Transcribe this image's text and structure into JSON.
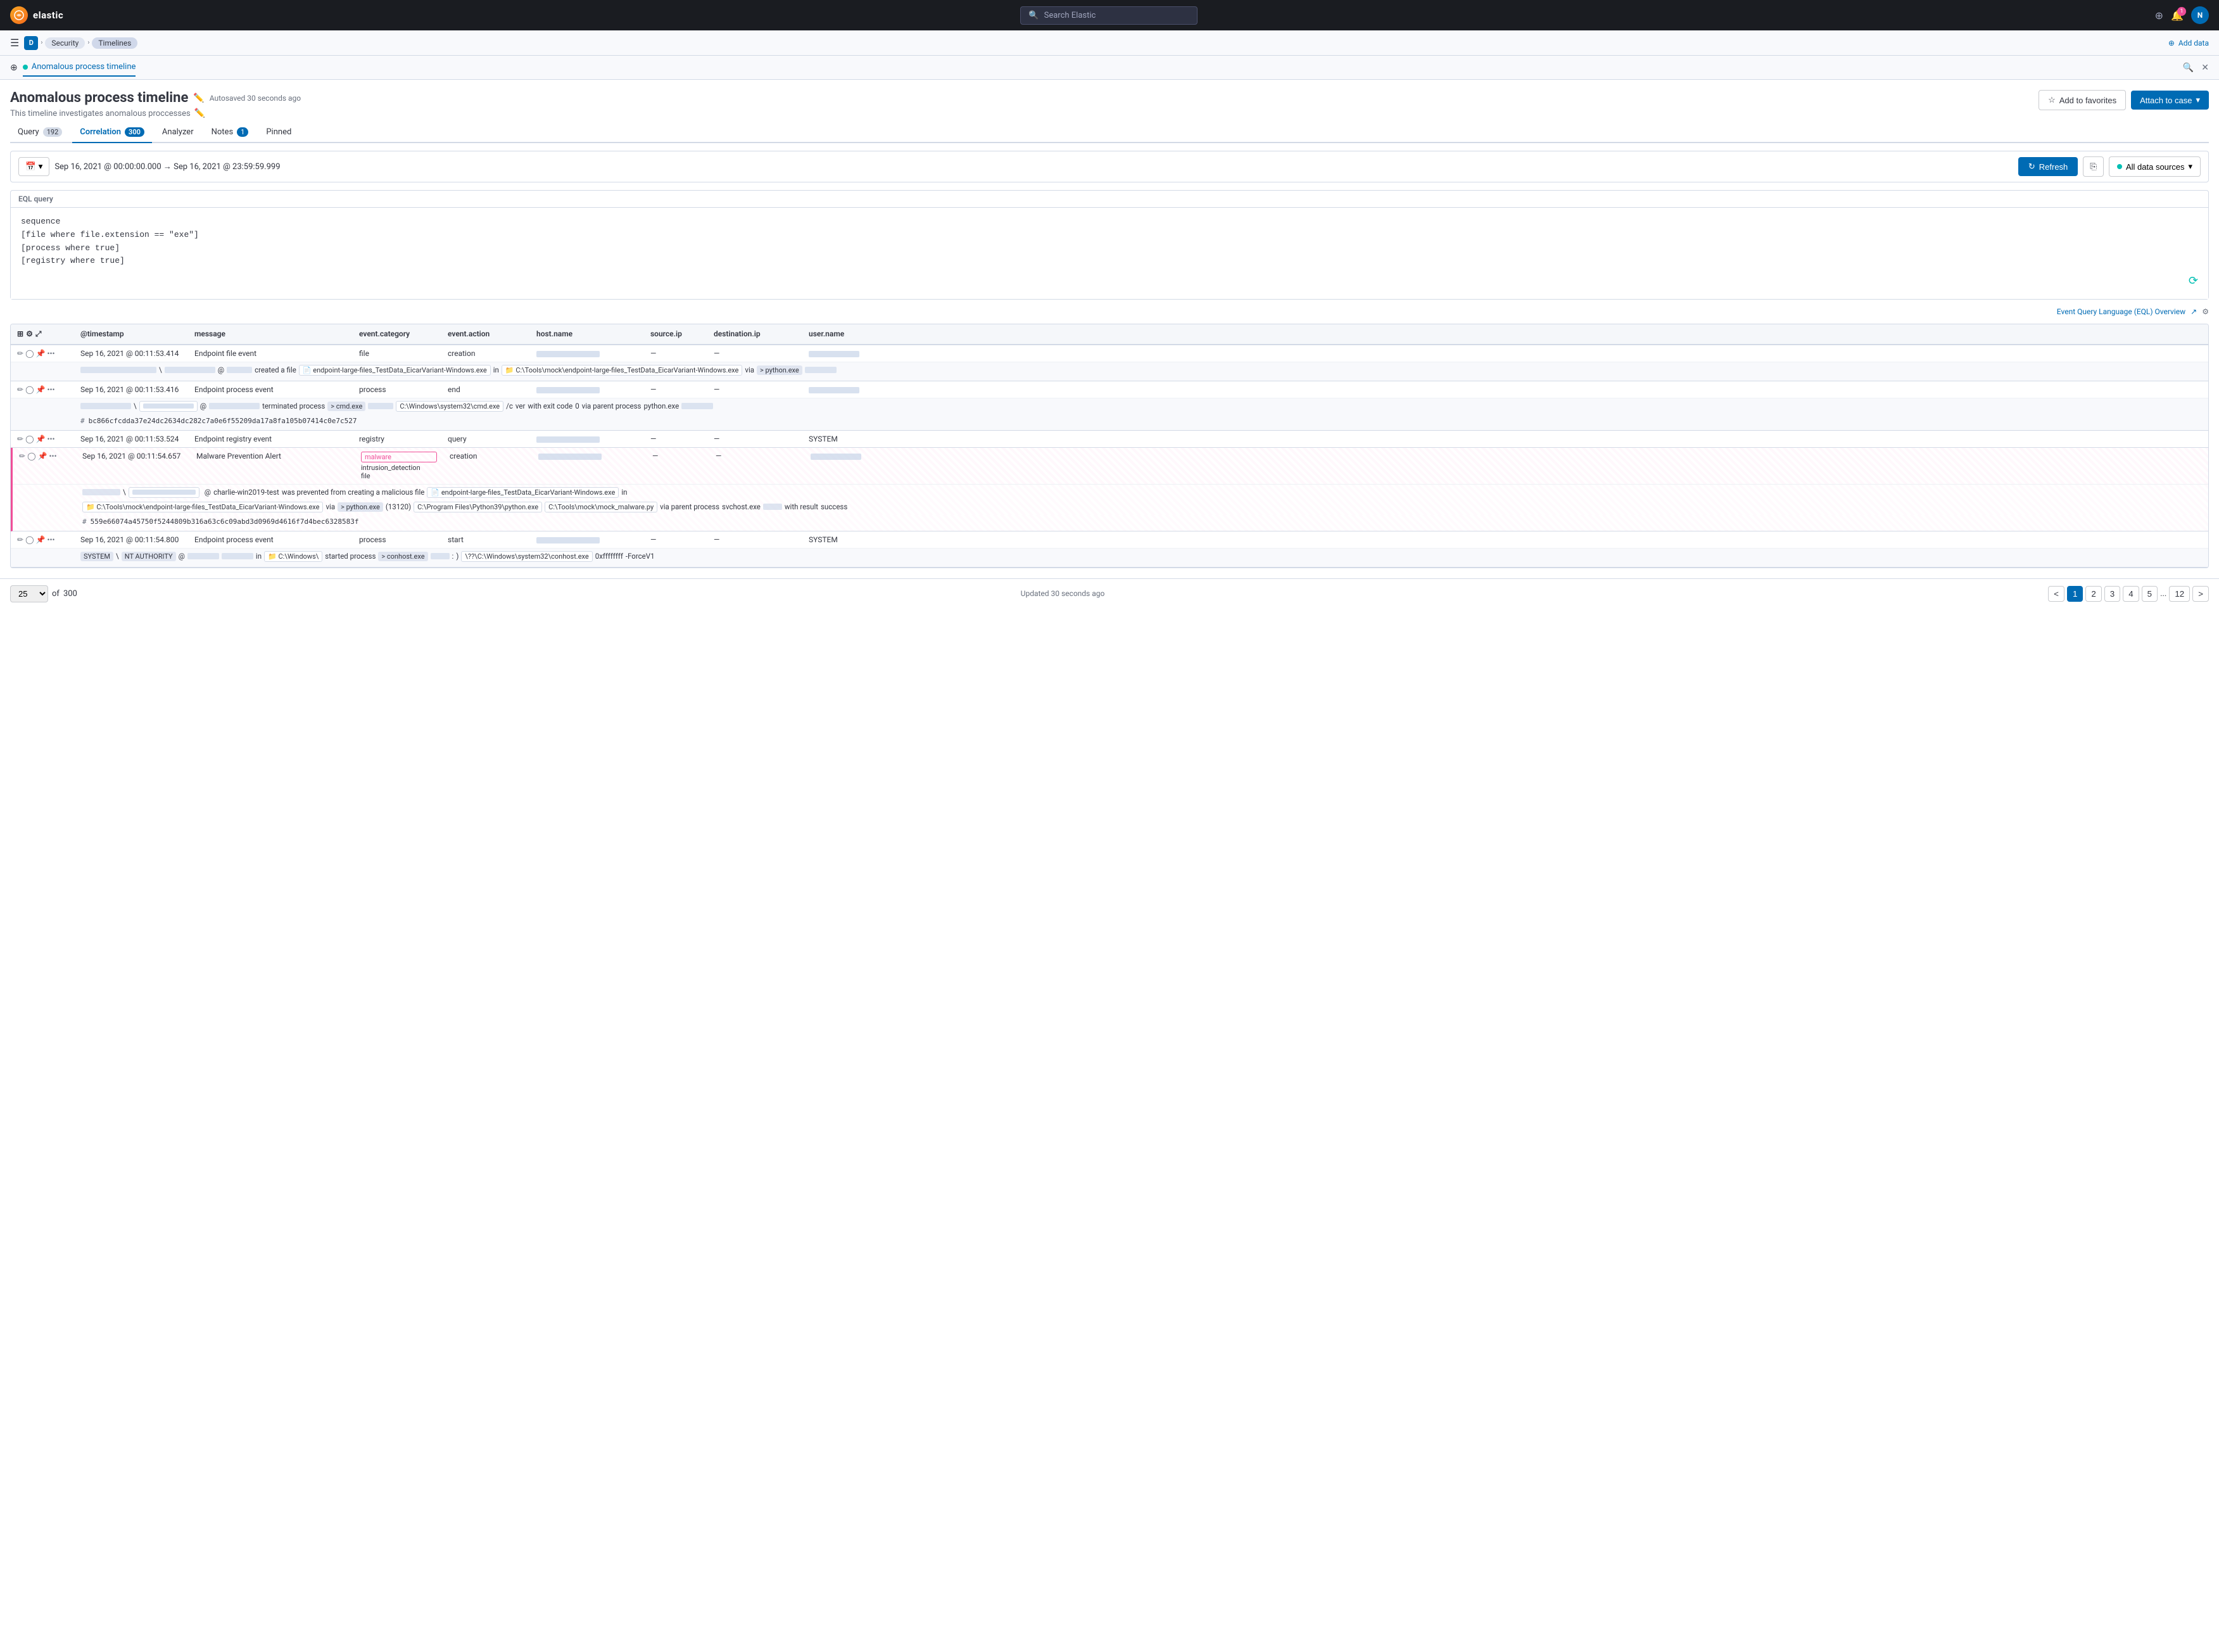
{
  "topNav": {
    "logo": "elastic",
    "logoInitial": "e",
    "searchPlaceholder": "Search Elastic",
    "notifCount": "1",
    "userInitial": "N"
  },
  "secondaryNav": {
    "breadcrumbs": [
      "D",
      "Security",
      "Timelines"
    ],
    "addDataLabel": "Add data"
  },
  "timelineTab": {
    "dotColor": "#00bfb3",
    "title": "Anomalous process timeline"
  },
  "pageTitle": "Anomalous process timeline",
  "autosaved": "Autosaved 30 seconds ago",
  "subtitle": "This timeline investigates anomalous proccesses",
  "buttons": {
    "addToFavorites": "Add to favorites",
    "attachToCase": "Attach to case"
  },
  "tabs": [
    {
      "label": "Query",
      "badge": "192",
      "active": false
    },
    {
      "label": "Correlation",
      "badge": "300",
      "active": true
    },
    {
      "label": "Analyzer",
      "badge": null,
      "active": false
    },
    {
      "label": "Notes",
      "badge": "1",
      "active": false
    },
    {
      "label": "Pinned",
      "badge": null,
      "active": false
    }
  ],
  "dateRange": {
    "start": "Sep 16, 2021 @ 00:00:00.000",
    "arrow": "→",
    "end": "Sep 16, 2021 @ 23:59:59.999"
  },
  "refreshBtn": "Refresh",
  "dataSources": "All data sources",
  "eqlQuery": {
    "label": "EQL query",
    "code": "sequence\n[file where file.extension == \"exe\"]\n[process where true]\n[registry where true]",
    "footerLink": "Event Query Language (EQL) Overview"
  },
  "tableColumns": [
    "",
    "@timestamp",
    "message",
    "event.category",
    "event.action",
    "host.name",
    "source.ip",
    "destination.ip",
    "user.name"
  ],
  "events": [
    {
      "id": 1,
      "timestamp": "Sep 16, 2021 @ 00:11:53.414",
      "message": "Endpoint file event",
      "category": "file",
      "action": "creation",
      "hostname": "BLURRED",
      "sourceip": "—",
      "destip": "—",
      "username": "BLURRED",
      "highlight": false,
      "expanded": true,
      "expandedDetails": "created a file  endpoint-large-files_TestData_EicarVariant-Windows.exe  in  C:\\Tools\\mock\\endpoint-large-files_TestData_EicarVariant-Windows.exe  via  python.exe",
      "hash": null
    },
    {
      "id": 2,
      "timestamp": "Sep 16, 2021 @ 00:11:53.416",
      "message": "Endpoint process event",
      "category": "process",
      "action": "end",
      "hostname": "BLURRED",
      "sourceip": "—",
      "destip": "—",
      "username": "BLURRED",
      "highlight": false,
      "expanded": true,
      "expandedDetails": "terminated process  cmd.exe  C:\\Windows\\system32\\cmd.exe  /c  ver  with exit code  0  via parent process  python.exe",
      "hash": "bc866cfcdda37e24dc2634dc282c7a0e6f55209da17a8fa105b07414c0e7c527"
    },
    {
      "id": 3,
      "timestamp": "Sep 16, 2021 @ 00:11:53.524",
      "message": "Endpoint registry event",
      "category": "registry",
      "action": "query",
      "hostname": "BLURRED",
      "sourceip": "—",
      "destip": "—",
      "username": "SYSTEM",
      "highlight": false,
      "expanded": false,
      "expandedDetails": null,
      "hash": null
    },
    {
      "id": 4,
      "timestamp": "Sep 16, 2021 @ 00:11:54.657",
      "message": "Malware Prevention Alert",
      "category": "malware\nintrusion_detection\nfile",
      "action": "creation",
      "hostname": "BLURRED",
      "sourceip": "—",
      "destip": "—",
      "username": "BLURRED",
      "highlight": true,
      "expanded": true,
      "expandedDetails": "charlie-win2019-test  was prevented from creating a malicious file  endpoint-large-files_TestData_EicarVariant-Windows.exe  in  C:\\Tools\\mock\\endpoint-large-files_TestData_EicarVariant-Windows.exe  via  python.exe  (13120)  C:\\Program Files\\Python39\\python.exe  C:\\Tools\\mock\\mock_malware.py  via parent process  svchost.exe  with result  success",
      "hash": "559e66074a45750f5244809b316a63c6c09abd3d0969d4616f7d4bec6328583f"
    },
    {
      "id": 5,
      "timestamp": "Sep 16, 2021 @ 00:11:54.800",
      "message": "Endpoint process event",
      "category": "process",
      "action": "start",
      "hostname": "BLURRED",
      "sourceip": "—",
      "destip": "—",
      "username": "SYSTEM",
      "highlight": false,
      "expanded": true,
      "expandedDetails": "SYSTEM  \\  NT AUTHORITY  @  in  C:\\Windows\\  started process  conhost.exe  \\?\\C:\\Windows\\system32\\conhost.exe  0xffffffff  -ForceV1",
      "hash": null
    }
  ],
  "footer": {
    "perPage": "25",
    "ofLabel": "of",
    "total": "300",
    "updatedLabel": "Updated 30 seconds ago",
    "pages": [
      "1",
      "2",
      "3",
      "4",
      "5",
      "12"
    ]
  }
}
